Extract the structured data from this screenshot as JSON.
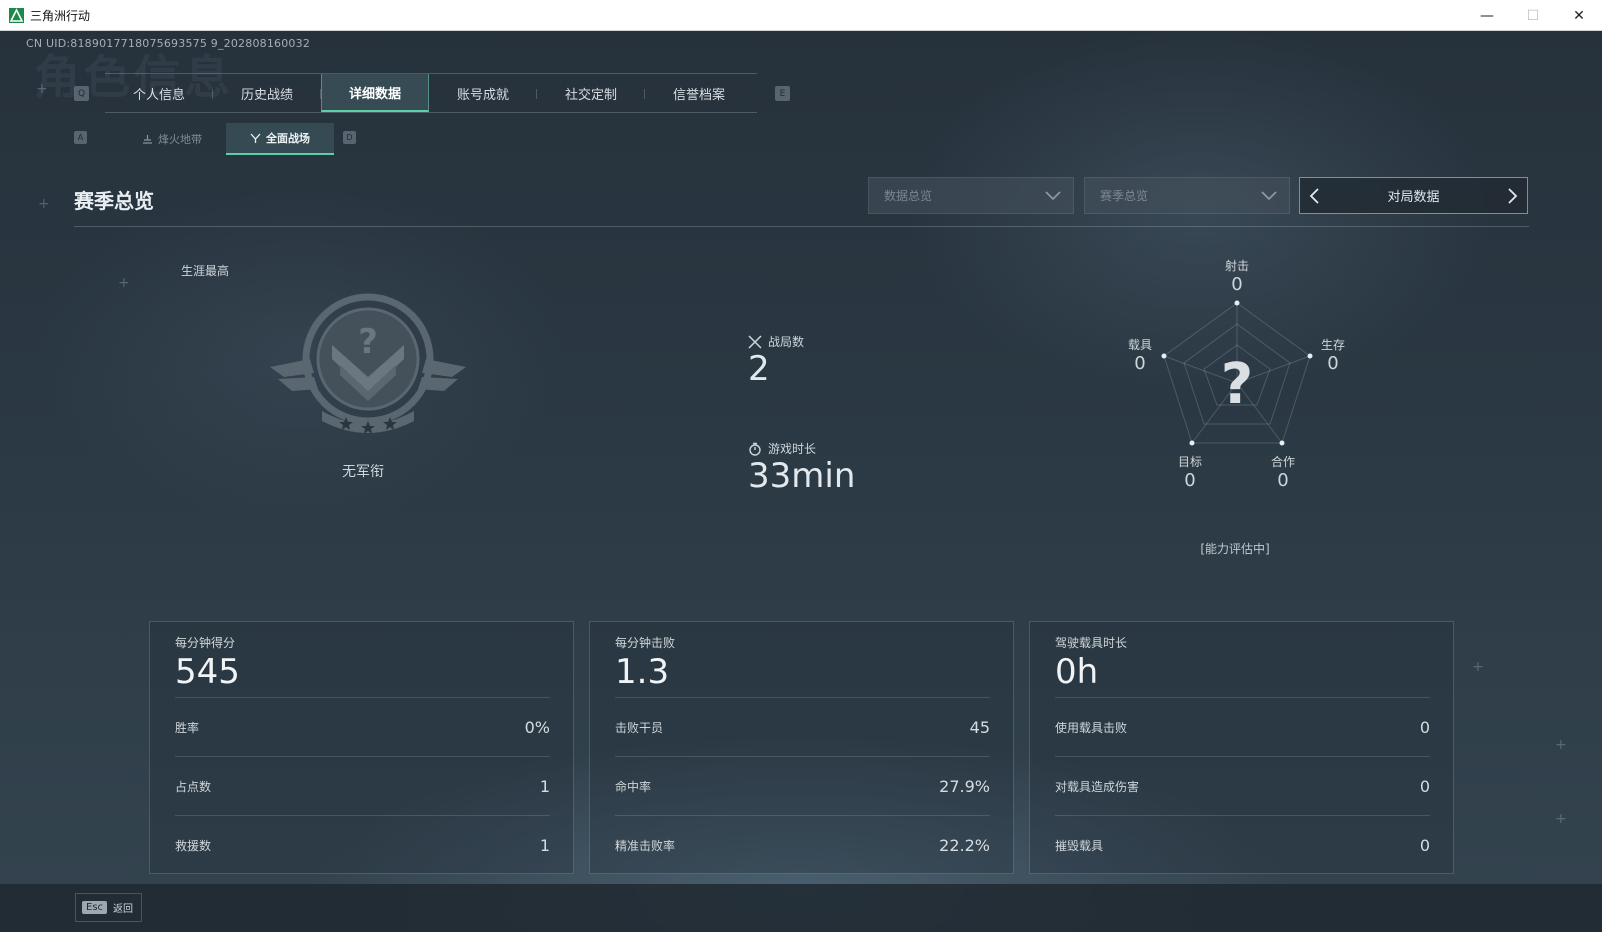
{
  "window": {
    "title": "三角洲行动",
    "controls": [
      "—",
      "☐",
      "✕"
    ]
  },
  "uid": "CN UID:8189017718075693575 9_202808160032",
  "watermark": "角色信息",
  "main_tabs": {
    "prev_key": "Q",
    "next_key": "E",
    "items": [
      {
        "label": "个人信息",
        "active": false
      },
      {
        "label": "历史战绩",
        "active": false
      },
      {
        "label": "详细数据",
        "active": true
      },
      {
        "label": "账号成就",
        "active": false
      },
      {
        "label": "社交定制",
        "active": false
      },
      {
        "label": "信誉档案",
        "active": false
      }
    ]
  },
  "sub_tabs": {
    "prev_key": "A",
    "next_key": "D",
    "items": [
      {
        "label": "烽火地带",
        "icon": "hazard-icon",
        "active": false
      },
      {
        "label": "全面战场",
        "icon": "battlefield-icon",
        "active": true
      }
    ]
  },
  "section": {
    "title": "赛季总览",
    "dropdown1": "数据总览",
    "dropdown2": "赛季总览",
    "switcher": "对局数据"
  },
  "career": {
    "label": "生涯最高",
    "rank": "无军衔",
    "badge_icon": "rank-badge-unknown"
  },
  "stats_center": {
    "matches_label": "战局数",
    "matches_value": "2",
    "playtime_label": "游戏时长",
    "playtime_value": "33min"
  },
  "radar": {
    "center_symbol": "?",
    "axes": [
      {
        "label": "射击",
        "value": "0"
      },
      {
        "label": "生存",
        "value": "0"
      },
      {
        "label": "合作",
        "value": "0"
      },
      {
        "label": "目标",
        "value": "0"
      },
      {
        "label": "载具",
        "value": "0"
      }
    ],
    "note": "[能力评估中]"
  },
  "cards": [
    {
      "head_label": "每分钟得分",
      "head_value": "545",
      "rows": [
        {
          "label": "胜率",
          "value": "0%"
        },
        {
          "label": "占点数",
          "value": "1"
        },
        {
          "label": "救援数",
          "value": "1"
        }
      ]
    },
    {
      "head_label": "每分钟击败",
      "head_value": "1.3",
      "rows": [
        {
          "label": "击败干员",
          "value": "45"
        },
        {
          "label": "命中率",
          "value": "27.9%"
        },
        {
          "label": "精准击败率",
          "value": "22.2%"
        }
      ]
    },
    {
      "head_label": "驾驶载具时长",
      "head_value": "0h",
      "rows": [
        {
          "label": "使用载具击败",
          "value": "0"
        },
        {
          "label": "对载具造成伤害",
          "value": "0"
        },
        {
          "label": "摧毁载具",
          "value": "0"
        }
      ]
    }
  ],
  "footer": {
    "esc_key": "Esc",
    "back_label": "返回"
  },
  "colors": {
    "accent": "#5fd0a6",
    "background": "#26313b"
  }
}
